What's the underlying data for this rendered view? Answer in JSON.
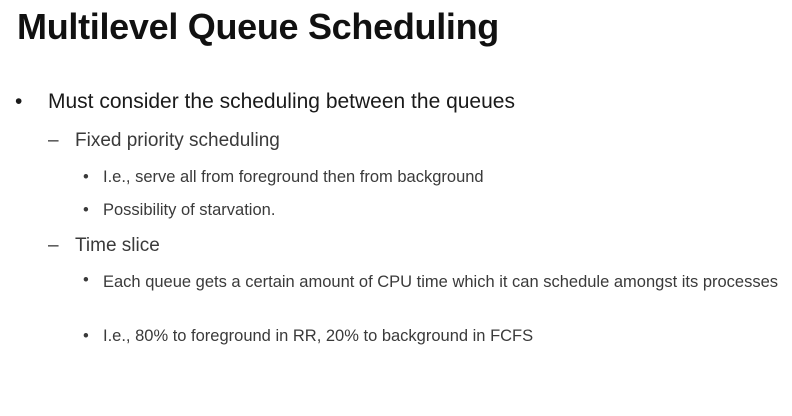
{
  "slide": {
    "title": "Multilevel Queue Scheduling",
    "bullets": [
      {
        "marker": "•",
        "text": "Must consider the scheduling between the queues",
        "children": [
          {
            "marker": "–",
            "text": "Fixed priority scheduling",
            "children": [
              {
                "marker": "•",
                "text": "I.e., serve all from foreground then from background"
              },
              {
                "marker": "•",
                "text": "Possibility of starvation."
              }
            ]
          },
          {
            "marker": "–",
            "text": "Time slice",
            "children": [
              {
                "marker": "•",
                "text": "Each queue gets a certain amount of CPU time which it can schedule amongst its processes"
              },
              {
                "marker": "•",
                "text": "I.e., 80% to foreground in RR, 20% to background in FCFS"
              }
            ]
          }
        ]
      }
    ]
  }
}
